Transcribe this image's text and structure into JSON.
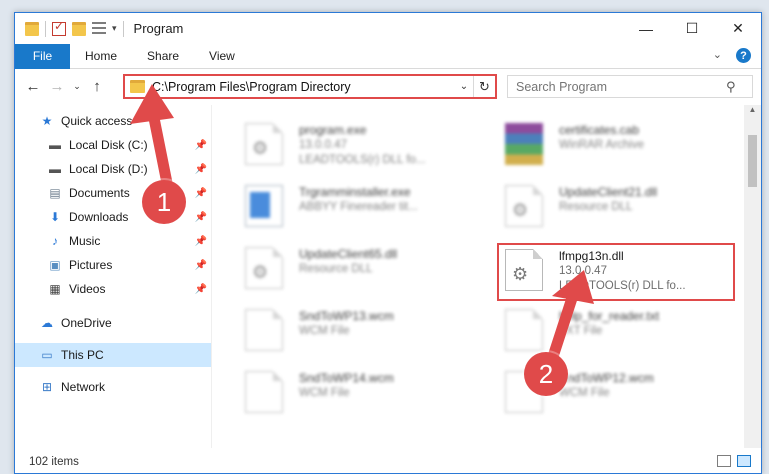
{
  "window": {
    "title": "Program",
    "minimize": "—",
    "maximize": "☐",
    "close": "✕"
  },
  "ribbon": {
    "file": "File",
    "tabs": [
      "Home",
      "Share",
      "View"
    ],
    "expand": "⌄",
    "help": "?"
  },
  "nav": {
    "back": "←",
    "forward": "→",
    "recent": "⌄",
    "up": "↑",
    "address": "C:\\Program Files\\Program Directory",
    "address_dropdown": "⌄",
    "refresh": "↻",
    "search_placeholder": "Search Program",
    "search_icon": "⚲"
  },
  "sidebar": {
    "items": [
      {
        "label": "Quick access",
        "icon": "star-icon"
      },
      {
        "label": "Local Disk (C:)",
        "icon": "drive-icon",
        "pinned": true
      },
      {
        "label": "Local Disk (D:)",
        "icon": "drive-icon",
        "pinned": true
      },
      {
        "label": "Documents",
        "icon": "documents-icon",
        "pinned": true
      },
      {
        "label": "Downloads",
        "icon": "downloads-icon",
        "pinned": true
      },
      {
        "label": "Music",
        "icon": "music-icon",
        "pinned": true
      },
      {
        "label": "Pictures",
        "icon": "pictures-icon",
        "pinned": true
      },
      {
        "label": "Videos",
        "icon": "videos-icon",
        "pinned": true
      },
      {
        "label": "OneDrive",
        "icon": "cloud-icon"
      },
      {
        "label": "This PC",
        "icon": "computer-icon",
        "selected": true
      },
      {
        "label": "Network",
        "icon": "network-icon"
      }
    ]
  },
  "files": [
    {
      "name": "program.exe",
      "line2": "13.0.0.47",
      "line3": "LEADTOOLS(r) DLL fo..."
    },
    {
      "name": "certificates.cab",
      "line2": "WinRAR Archive",
      "line3": ""
    },
    {
      "name": "Trgramminstaller.exe",
      "line2": "ABBYY Finereader tit...",
      "line3": ""
    },
    {
      "name": "UpdateClient21.dll",
      "line2": "Resource DLL",
      "line3": ""
    },
    {
      "name": "UpdateClient65.dll",
      "line2": "Resource DLL",
      "line3": ""
    },
    {
      "name": "lfmpg13n.dll",
      "line2": "13.0.0.47",
      "line3": "LEADTOOLS(r) DLL fo..."
    },
    {
      "name": "SndToWP13.wcm",
      "line2": "WCM File",
      "line3": ""
    },
    {
      "name": "help_for_reader.txt",
      "line2": "TXT File",
      "line3": ""
    },
    {
      "name": "SndToWP14.wcm",
      "line2": "WCM File",
      "line3": ""
    },
    {
      "name": "SndToWP12.wcm",
      "line2": "WCM File",
      "line3": ""
    }
  ],
  "status": {
    "count": "102 items"
  },
  "annotations": {
    "step1": "1",
    "step2": "2",
    "color": "#e04a4a"
  }
}
